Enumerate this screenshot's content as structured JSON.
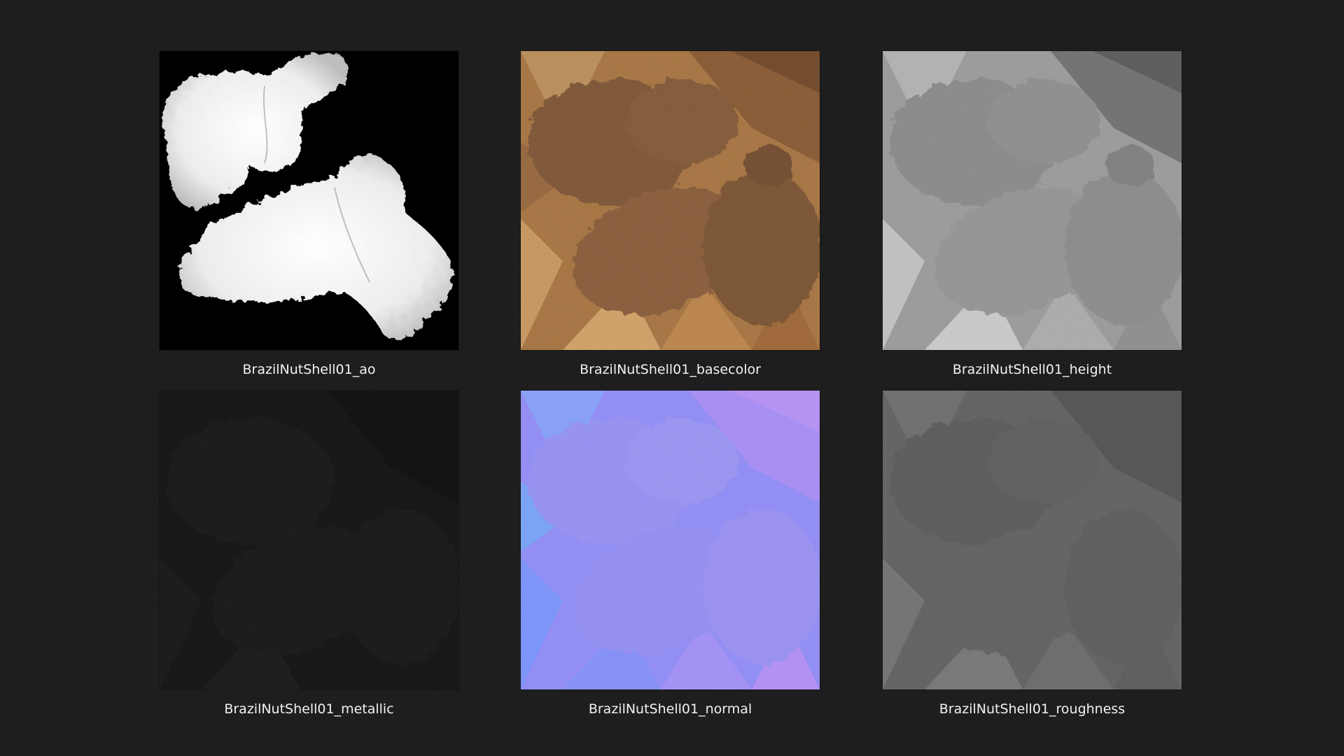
{
  "window": {
    "background": "#1e1e1e"
  },
  "files": [
    {
      "label": "BrazilNutShell01_ao",
      "map": "ambient-occlusion"
    },
    {
      "label": "BrazilNutShell01_basecolor",
      "map": "base-color"
    },
    {
      "label": "BrazilNutShell01_height",
      "map": "height"
    },
    {
      "label": "BrazilNutShell01_metallic",
      "map": "metallic"
    },
    {
      "label": "BrazilNutShell01_normal",
      "map": "normal"
    },
    {
      "label": "BrazilNutShell01_roughness",
      "map": "roughness"
    }
  ]
}
